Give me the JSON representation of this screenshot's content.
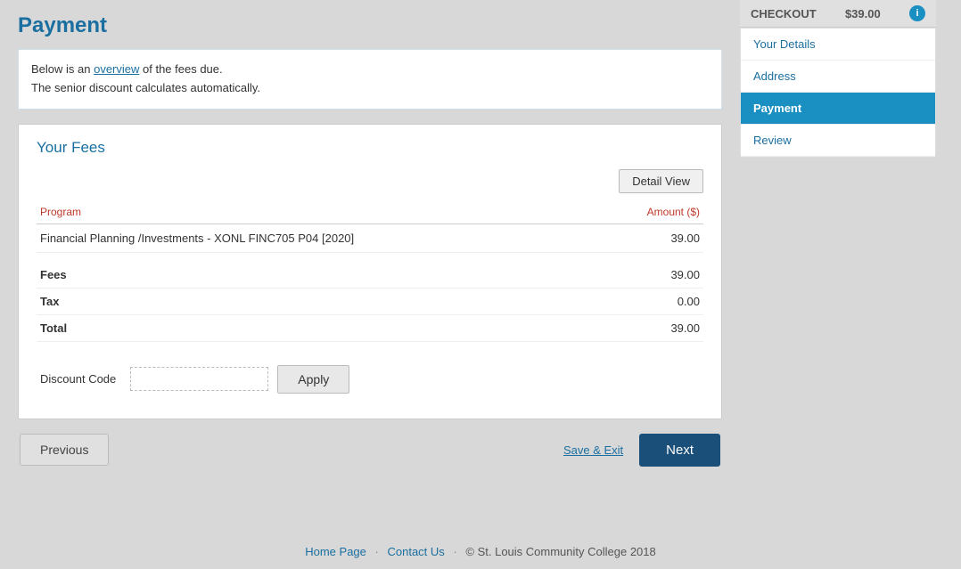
{
  "page": {
    "title": "Payment",
    "info_line1": "Below is an overview of the fees due.",
    "info_line2": "The senior discount calculates automatically.",
    "info_highlight": "overview"
  },
  "fees_section": {
    "title": "Your Fees",
    "detail_view_btn": "Detail View",
    "table": {
      "headers": {
        "program": "Program",
        "amount": "Amount ($)"
      },
      "rows": [
        {
          "program": "Financial Planning /Investments - XONL FINC705 P04 [2020]",
          "amount": "39.00"
        }
      ]
    },
    "summary": [
      {
        "label": "Fees",
        "value": "39.00"
      },
      {
        "label": "Tax",
        "value": "0.00"
      },
      {
        "label": "Total",
        "value": "39.00"
      }
    ],
    "discount_label": "Discount Code",
    "discount_placeholder": "",
    "apply_btn": "Apply"
  },
  "navigation": {
    "previous_btn": "Previous",
    "save_exit_link": "Save & Exit",
    "next_btn": "Next"
  },
  "sidebar": {
    "checkout_label": "CHECKOUT",
    "checkout_price": "$39.00",
    "info_icon": "i",
    "nav_items": [
      {
        "label": "Your Details",
        "active": false
      },
      {
        "label": "Address",
        "active": false
      },
      {
        "label": "Payment",
        "active": true
      },
      {
        "label": "Review",
        "active": false
      }
    ]
  },
  "footer": {
    "home_page": "Home Page",
    "contact_us": "Contact Us",
    "copyright": "© St. Louis Community College 2018"
  }
}
